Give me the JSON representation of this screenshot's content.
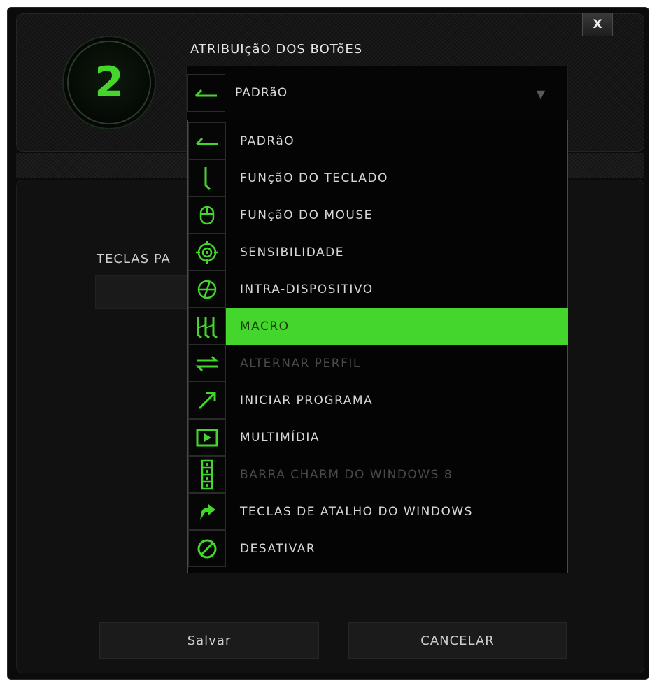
{
  "colors": {
    "accent": "#44d62c",
    "background": "#0b0b0b",
    "disabled_text": "#4a4a4a"
  },
  "close_label": "X",
  "button_number": "2",
  "section_title": "ATRIBUIçãO DOS BOTõES",
  "select": {
    "value": "PADRãO",
    "icon": "default-arrow-icon",
    "arrow": "▼"
  },
  "keys_label": "TECLAS PA",
  "dropdown": {
    "items": [
      {
        "label": "PADRãO",
        "icon": "default-arrow-icon",
        "state": "normal"
      },
      {
        "label": "FUNçãO DO TECLADO",
        "icon": "keyboard-function-icon",
        "state": "normal"
      },
      {
        "label": "FUNçãO DO MOUSE",
        "icon": "mouse-icon",
        "state": "normal"
      },
      {
        "label": "SENSIBILIDADE",
        "icon": "sensitivity-icon",
        "state": "normal"
      },
      {
        "label": "INTRA-DISPOSITIVO",
        "icon": "inter-device-icon",
        "state": "normal"
      },
      {
        "label": "MACRO",
        "icon": "macro-icon",
        "state": "selected"
      },
      {
        "label": "ALTERNAR PERFIL",
        "icon": "switch-profile-icon",
        "state": "disabled"
      },
      {
        "label": "INICIAR PROGRAMA",
        "icon": "launch-program-icon",
        "state": "normal"
      },
      {
        "label": "MULTIMÍDIA",
        "icon": "multimedia-icon",
        "state": "normal"
      },
      {
        "label": "BARRA CHARM DO WINDOWS 8",
        "icon": "windows-charm-icon",
        "state": "disabled"
      },
      {
        "label": "TECLAS DE ATALHO DO WINDOWS",
        "icon": "windows-shortcut-icon",
        "state": "normal"
      },
      {
        "label": "DESATIVAR",
        "icon": "disable-icon",
        "state": "normal"
      }
    ]
  },
  "buttons": {
    "save": "Salvar",
    "cancel": "CANCELAR"
  }
}
